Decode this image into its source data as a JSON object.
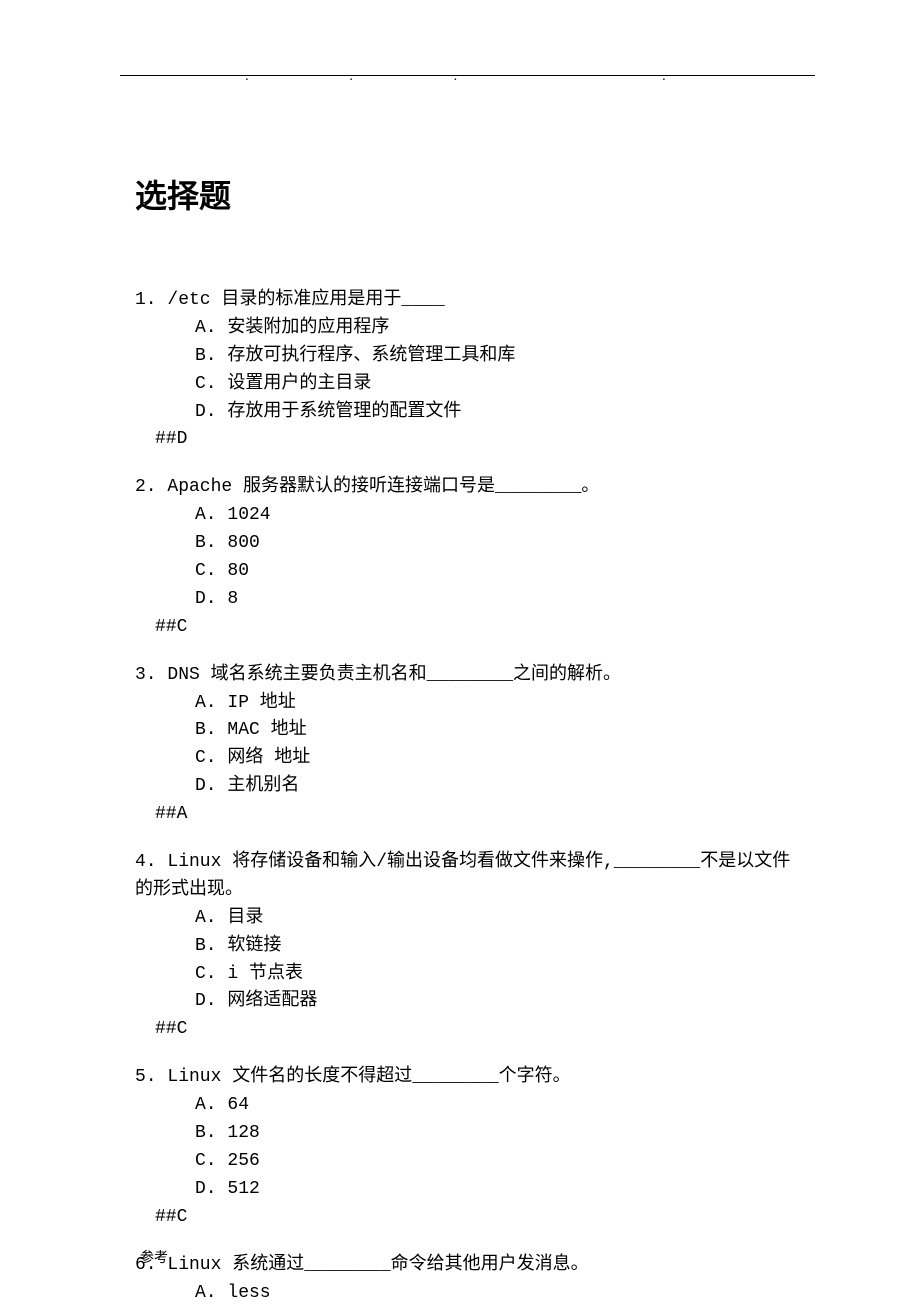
{
  "heading": "选择题",
  "q1": {
    "stem": "1. /etc 目录的标准应用是用于____",
    "a": "A. 安装附加的应用程序",
    "b": "B. 存放可执行程序、系统管理工具和库",
    "c": "C. 设置用户的主目录",
    "d": "D. 存放用于系统管理的配置文件",
    "ans": "##D"
  },
  "q2": {
    "stem": "2. Apache 服务器默认的接听连接端口号是________。",
    "a": "A. 1024",
    "b": "B. 800",
    "c": "C. 80",
    "d": "D. 8",
    "ans": "##C"
  },
  "q3": {
    "stem": "3. DNS 域名系统主要负责主机名和________之间的解析。",
    "a": "A. IP 地址",
    "b": "B. MAC 地址",
    "c": "C. 网络 地址",
    "d": "D. 主机别名",
    "ans": "##A"
  },
  "q4": {
    "stem": "4. Linux 将存储设备和输入/输出设备均看做文件来操作,________不是以文件的形式出现。",
    "a": "A.  目录",
    "b": "B.  软链接",
    "c": "C.  i 节点表",
    "d": "D.  网络适配器",
    "ans": "##C"
  },
  "q5": {
    "stem": "5. Linux 文件名的长度不得超过________个字符。",
    "a": "A. 64",
    "b": "B. 128",
    "c": "C. 256",
    "d": "D. 512",
    "ans": "##C"
  },
  "q6": {
    "stem": "6. Linux 系统通过________命令给其他用户发消息。",
    "a": "A. less"
  },
  "footer": "参考"
}
